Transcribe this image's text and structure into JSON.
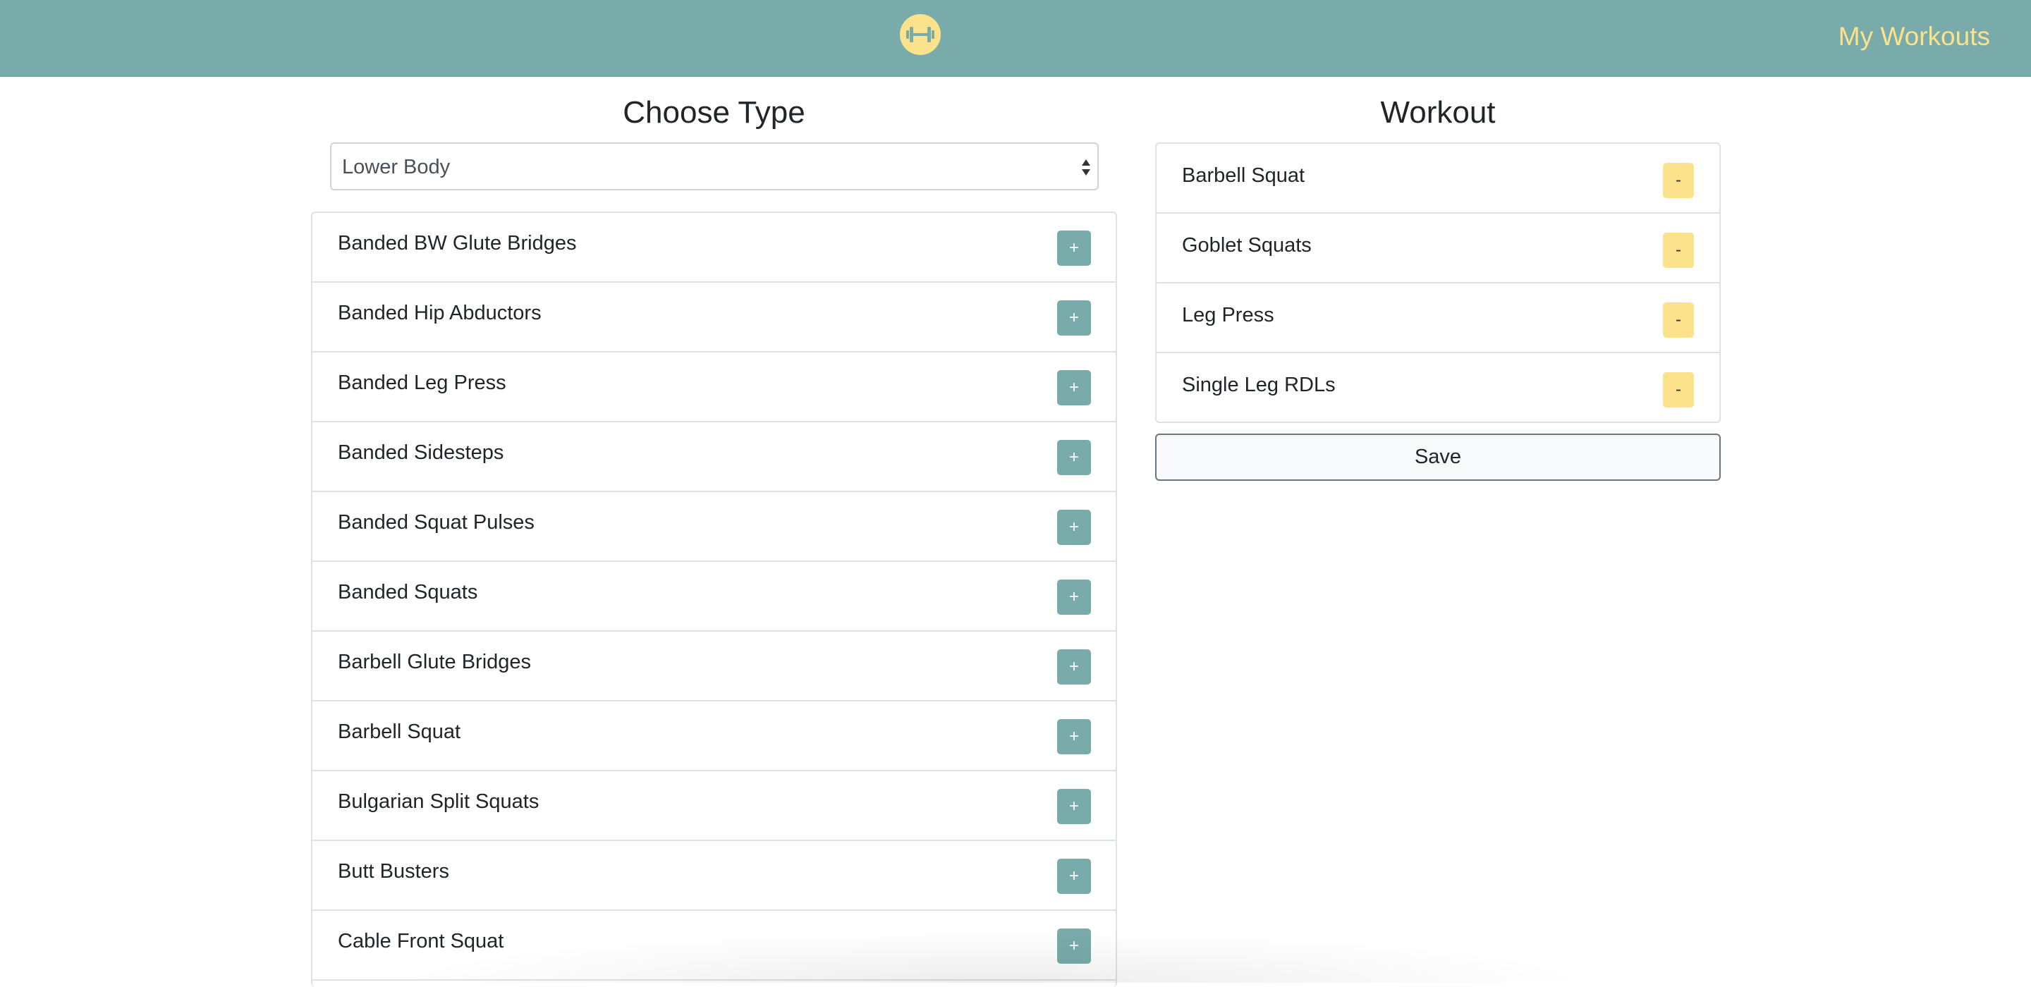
{
  "nav": {
    "logo_icon": "dumbbell-icon",
    "link_label": "My Workouts"
  },
  "chooser": {
    "title": "Choose Type",
    "select_value": "Lower Body",
    "exercises": [
      "Banded BW Glute Bridges",
      "Banded Hip Abductors",
      "Banded Leg Press",
      "Banded Sidesteps",
      "Banded Squat Pulses",
      "Banded Squats",
      "Barbell Glute Bridges",
      "Barbell Squat",
      "Bulgarian Split Squats",
      "Butt Busters",
      "Cable Front Squat"
    ],
    "add_label": "+"
  },
  "workout": {
    "title": "Workout",
    "items": [
      "Barbell Squat",
      "Goblet Squats",
      "Leg Press",
      "Single Leg RDLs"
    ],
    "remove_label": "-",
    "save_label": "Save"
  },
  "colors": {
    "accent": "#7aabab",
    "highlight": "#fbe28b"
  }
}
